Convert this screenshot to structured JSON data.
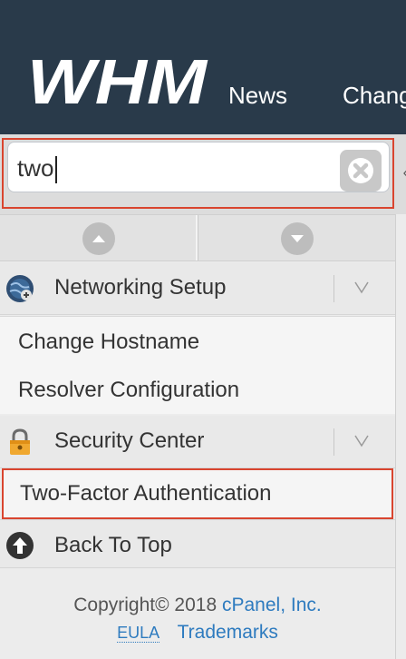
{
  "header": {
    "logo_text": "WHM",
    "nav": [
      "News",
      "Chang"
    ]
  },
  "search": {
    "value": "two",
    "clear_label": "clear-icon"
  },
  "scroll": {
    "up_icon": "chevron-up-circle-icon",
    "down_icon": "chevron-down-circle-icon"
  },
  "categories": [
    {
      "label": "Networking Setup",
      "icon": "globe-network-icon",
      "items": [
        "Change Hostname",
        "Resolver Configuration"
      ]
    },
    {
      "label": "Security Center",
      "icon": "lock-icon",
      "items": [
        "Two-Factor Authentication"
      ]
    }
  ],
  "back_to_top": "Back To Top",
  "footer": {
    "copyright_prefix": "Copyright© 2018",
    "company": "cPanel, Inc.",
    "eula": "EULA",
    "trademarks": "Trademarks"
  },
  "colors": {
    "header_bg": "#293a4a",
    "highlight": "#d9452f",
    "link": "#2e7bbf",
    "lock": "#f0a830"
  }
}
